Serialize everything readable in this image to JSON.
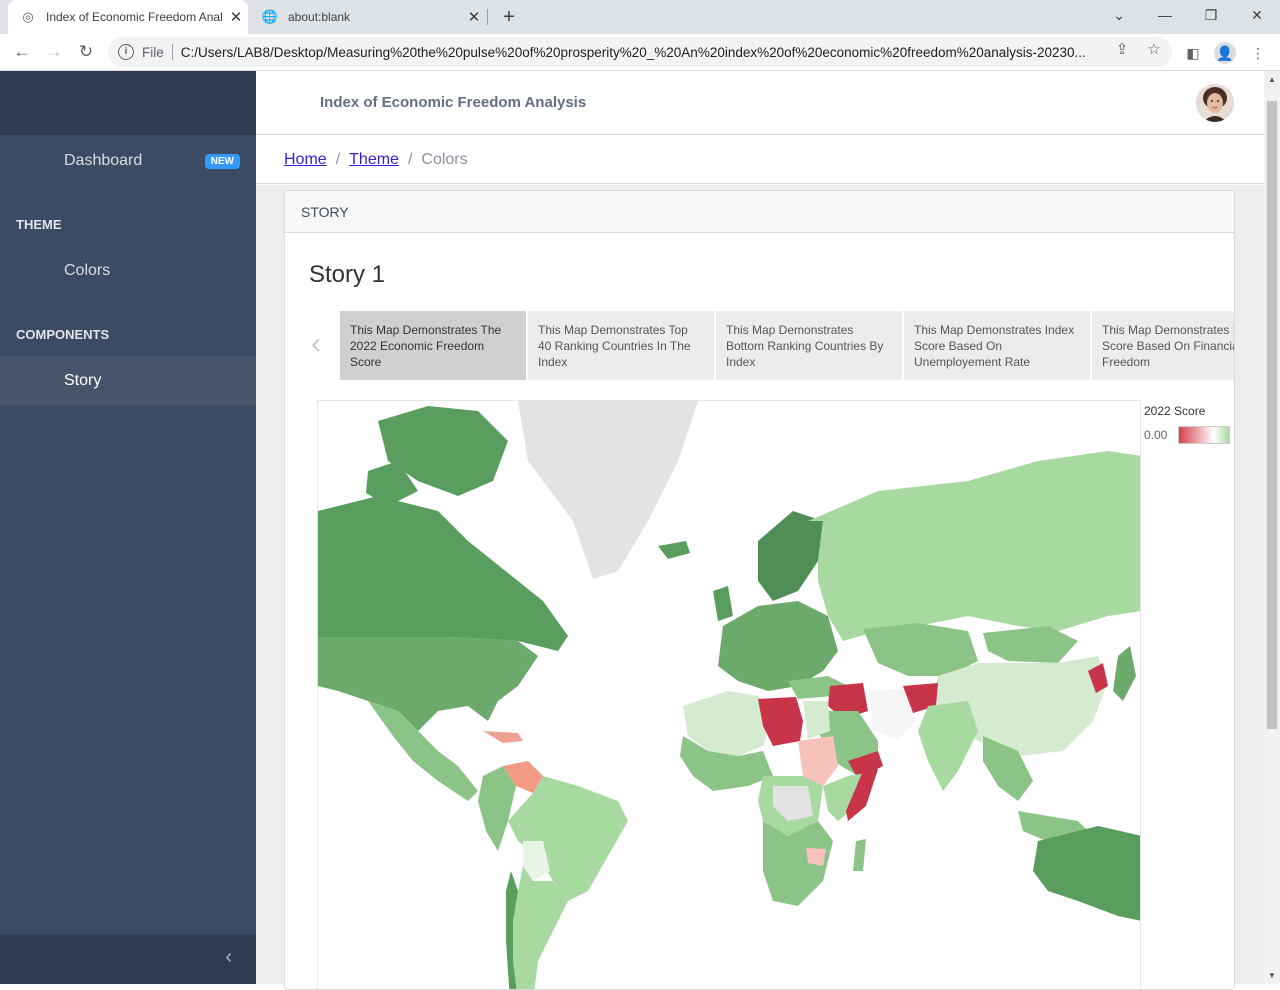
{
  "browser": {
    "tabs": [
      {
        "title": "Index of Economic Freedom Anal",
        "icon": "tableau-icon"
      },
      {
        "title": "about:blank",
        "icon": "globe-icon"
      }
    ],
    "file_label": "File",
    "url": "C:/Users/LAB8/Desktop/Measuring%20the%20pulse%20of%20prosperity%20_%20An%20index%20of%20economic%20freedom%20analysis-20230..."
  },
  "sidebar": {
    "dashboard_label": "Dashboard",
    "dashboard_badge": "NEW",
    "section_theme": "THEME",
    "colors_label": "Colors",
    "section_components": "COMPONENTS",
    "story_label": "Story"
  },
  "header": {
    "title": "Index of Economic Freedom Analysis"
  },
  "breadcrumb": {
    "home": "Home",
    "theme": "Theme",
    "current": "Colors"
  },
  "card": {
    "header": "STORY",
    "story_title": "Story 1",
    "story_points": [
      "This Map Demonstrates The 2022 Economic Freedom Score",
      "This Map Demonstrates Top 40 Ranking Countries In The Index",
      "This Map Demonstrates Bottom Ranking Countries By Index",
      "This Map Demonstrates Index Score Based On Unemployement Rate",
      "This Map Demonstrates Index Score Based On Financial Freedom"
    ]
  },
  "legend": {
    "title": "2022 Score",
    "min_value": "0.00"
  },
  "colors": {
    "sidebar": "#3c4b64",
    "accent": "#321fdb",
    "badge": "#3399ff",
    "map_high": "#5a9e5f",
    "map_low": "#c8344a"
  }
}
